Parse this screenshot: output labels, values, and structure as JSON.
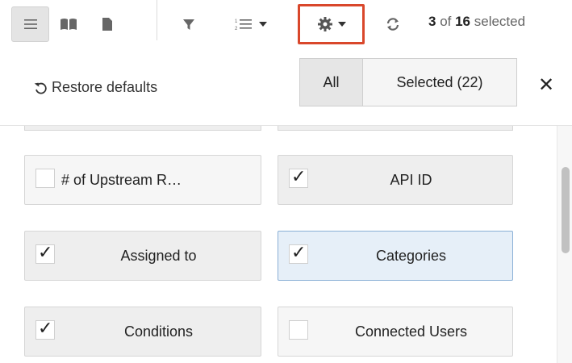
{
  "toolbar": {
    "icons": [
      "list-view-icon",
      "book-view-icon",
      "page-view-icon",
      "filter-icon",
      "sort-list-icon",
      "gear-icon",
      "refresh-icon"
    ],
    "selection": {
      "count": "3",
      "of_text": " of ",
      "total": "16",
      "suffix": " selected"
    },
    "active_button_outline": "#d9472b"
  },
  "panel": {
    "restore_label": "Restore defaults",
    "segments": {
      "all": "All",
      "selected": "Selected (22)"
    },
    "close_glyph": "✕"
  },
  "fields": [
    {
      "label": "# of Upstream R…",
      "checked": false
    },
    {
      "label": "API ID",
      "checked": true
    },
    {
      "label": "Assigned to",
      "checked": true
    },
    {
      "label": "Categories",
      "checked": true,
      "active": true
    },
    {
      "label": "Conditions",
      "checked": true
    },
    {
      "label": "Connected Users",
      "checked": false
    }
  ],
  "colors": {
    "accent_outline": "#d9472b",
    "active_field": "#e6eff8",
    "active_field_border": "#8ab0d6"
  }
}
